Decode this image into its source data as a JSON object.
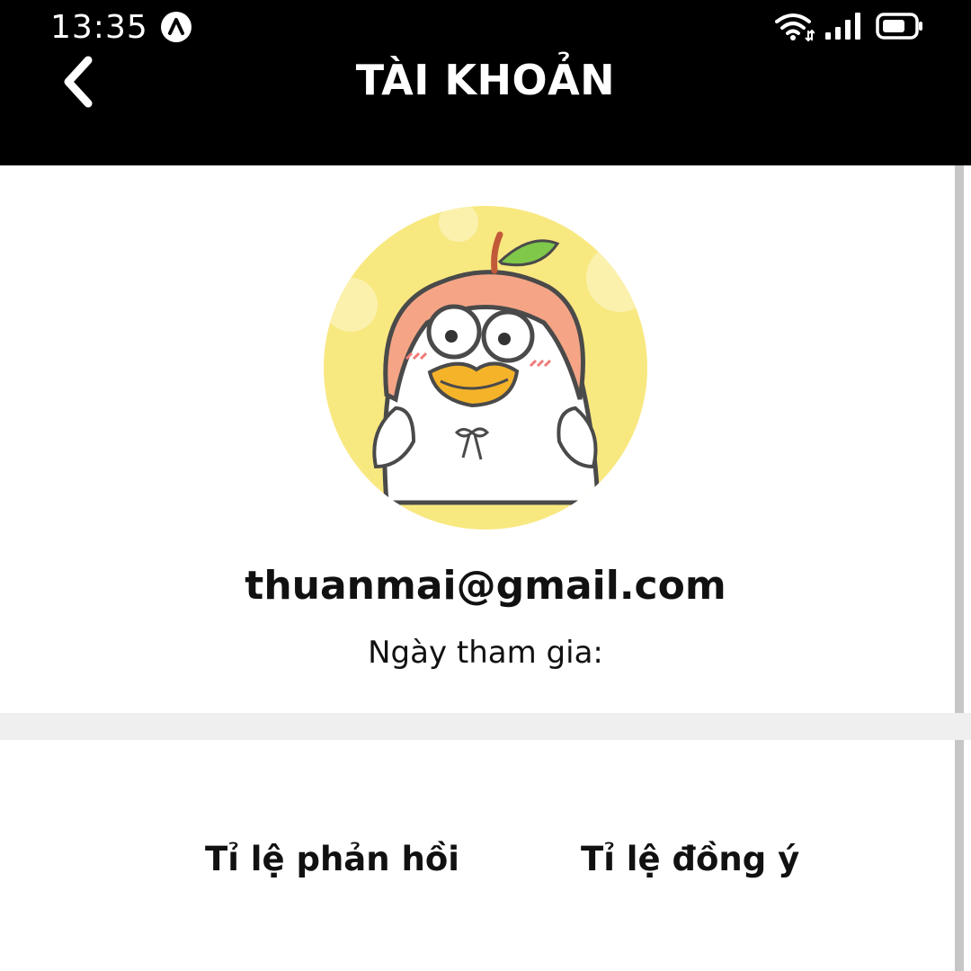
{
  "status_bar": {
    "time": "13:35",
    "icons": [
      "notification-app-icon",
      "wifi-icon",
      "signal-icon",
      "battery-icon"
    ]
  },
  "header": {
    "back_icon": "chevron-left-icon",
    "title": "TÀI KHOẢN"
  },
  "profile": {
    "avatar": "duck-character-avatar",
    "email": "thuanmai@gmail.com",
    "join_date_label": "Ngày tham gia:"
  },
  "stats": {
    "response_rate_label": "Tỉ lệ phản hồi",
    "agree_rate_label": "Tỉ lệ đồng ý"
  },
  "colors": {
    "header_bg": "#000000",
    "background": "#ffffff",
    "divider": "#efefef",
    "avatar_bg": "#f8e880",
    "hood": "#f5a586",
    "beak": "#f5b32a"
  }
}
